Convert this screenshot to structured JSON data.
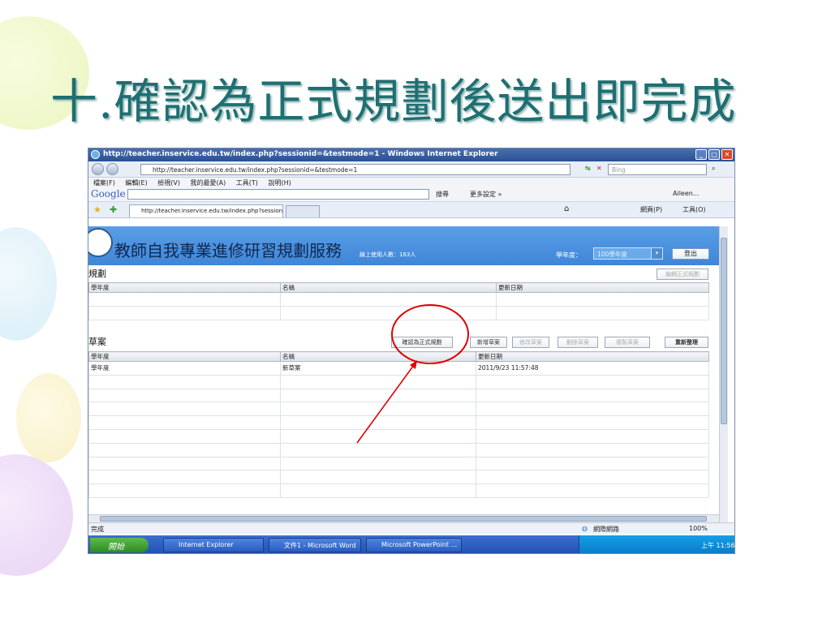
{
  "slide": {
    "title": "十.確認為正式規劃後送出即完成"
  },
  "browser": {
    "title": "http://teacher.inservice.edu.tw/index.php?sessionid=&testmode=1 - Windows Internet Explorer",
    "url": "http://teacher.inservice.edu.tw/index.php?sessionid=&testmode=1",
    "search_placeholder": "Bing",
    "menu": [
      "檔案(F)",
      "編輯(E)",
      "檢視(V)",
      "我的最愛(A)",
      "工具(T)",
      "說明(H)"
    ],
    "google_label": "Google",
    "google_search": "搜尋",
    "more_settings": "更多設定 »",
    "user": "Aileen...",
    "tab_title": "http://teacher.inservice.edu.tw/index.php?sessionid=&te...",
    "cmd_page": "網頁(P)",
    "cmd_tools": "工具(O)"
  },
  "app": {
    "title": "教師自我專業進修研習規劃服務",
    "online_users": "線上使用人數：163人",
    "year_label": "學年度：",
    "year_value": "100學年度",
    "logout": "登出"
  },
  "plan_section": {
    "title": "規劃",
    "edit_button": "編輯正式規劃",
    "columns": [
      "學年度",
      "名稱",
      "更新日期"
    ]
  },
  "draft_section": {
    "title": "草案",
    "buttons": {
      "confirm": "確認為正式規劃",
      "add": "新增草案",
      "modify": "修改草案",
      "delete": "刪除草案",
      "copy": "複製草案",
      "refresh": "重新整理"
    },
    "columns": [
      "學年度",
      "名稱",
      "更新日期"
    ],
    "rows": [
      [
        "學年度",
        "新草案",
        "2011/9/23 11:57:48"
      ]
    ]
  },
  "statusbar": {
    "text": "完成",
    "zone": "網際網路",
    "zoom": "100%"
  },
  "taskbar": {
    "start": "開始",
    "items": [
      "Internet Explorer",
      "文件1 - Microsoft Word",
      "Microsoft PowerPoint ..."
    ],
    "clock": "上午 11:56"
  },
  "colors": {
    "title": "#1f6f72",
    "banner": "#4a90e0",
    "annotation": "#e00000"
  }
}
